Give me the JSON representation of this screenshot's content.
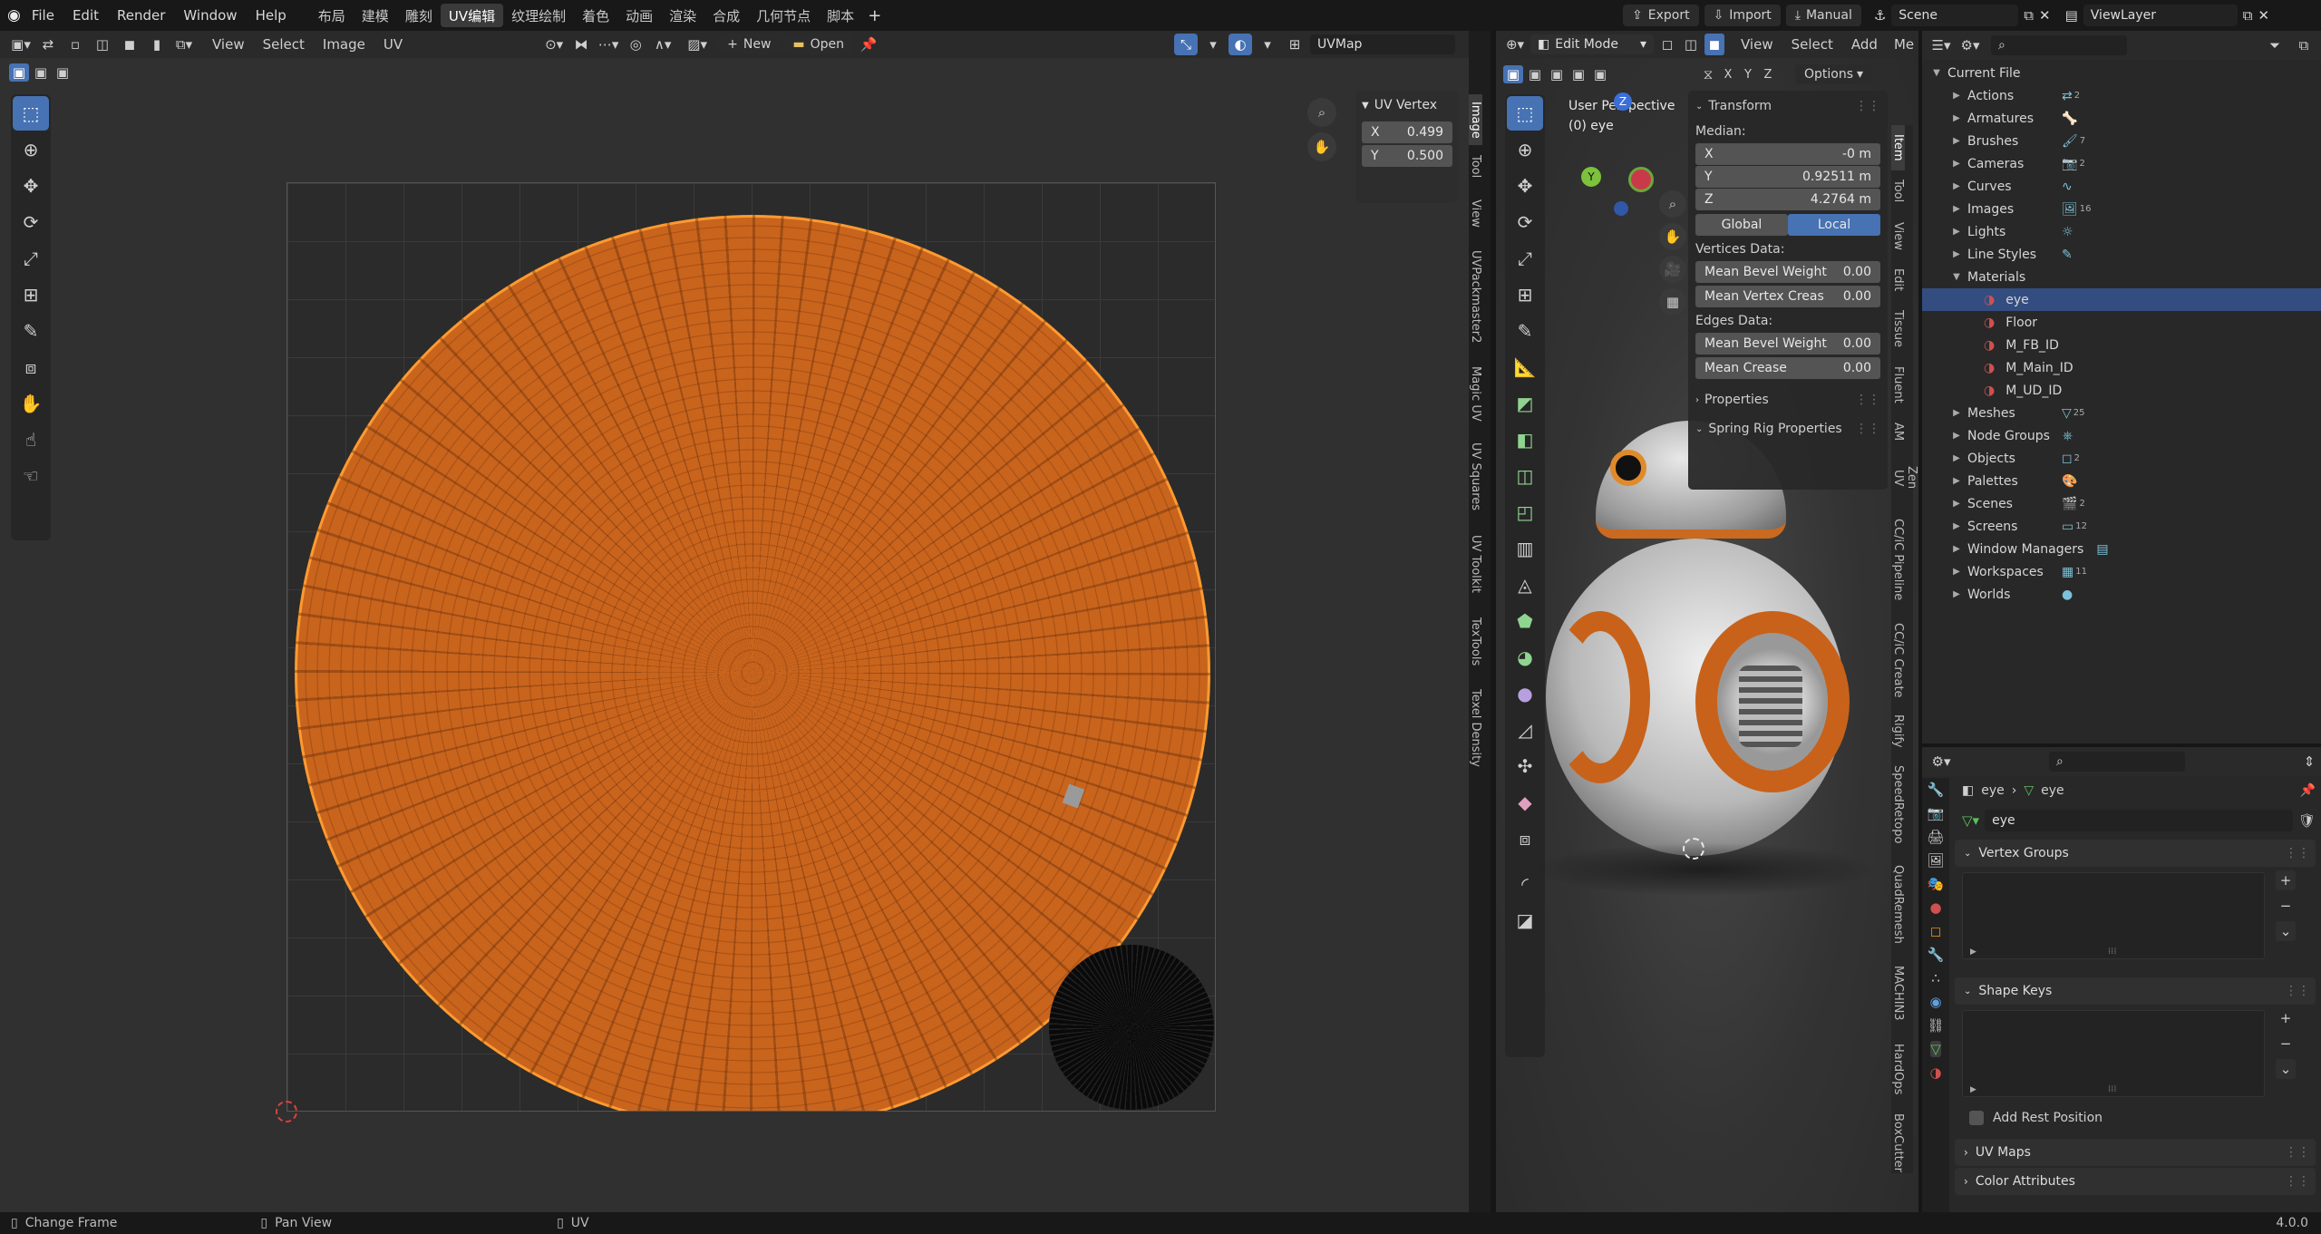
{
  "menu": {
    "file": "File",
    "edit": "Edit",
    "render": "Render",
    "window": "Window",
    "help": "Help"
  },
  "workspaces": [
    "布局",
    "建模",
    "雕刻",
    "UV编辑",
    "纹理绘制",
    "着色",
    "动画",
    "渲染",
    "合成",
    "几何节点",
    "脚本"
  ],
  "active_workspace": "UV编辑",
  "topright": {
    "export": "Export",
    "import": "Import",
    "manual": "Manual",
    "scene": "Scene",
    "viewlayer": "ViewLayer"
  },
  "uv_editor": {
    "view": "View",
    "select": "Select",
    "image": "Image",
    "uv": "UV",
    "new": "New",
    "open": "Open",
    "uvmap": "UVMap",
    "vertex_panel": {
      "title": "UV Vertex",
      "x_label": "X",
      "x_value": "0.499",
      "y_label": "Y",
      "y_value": "0.500"
    },
    "tabs": [
      "Image",
      "Tool",
      "View",
      "UVPackmaster2",
      "Magic UV",
      "UV Squares",
      "UV Toolkit",
      "TexTools",
      "Texel Density"
    ]
  },
  "viewport": {
    "mode": "Edit Mode",
    "view": "View",
    "select": "Select",
    "add": "Add",
    "mesh": "Me",
    "options": "Options",
    "overlay_title": "User Perspective",
    "overlay_object": "(0) eye",
    "axes": {
      "x": "X",
      "y": "Y",
      "z": "Z"
    },
    "transform": {
      "title": "Transform",
      "median": "Median:",
      "x_label": "X",
      "x_value": "-0 m",
      "y_label": "Y",
      "y_value": "0.92511 m",
      "z_label": "Z",
      "z_value": "4.2764 m",
      "global": "Global",
      "local": "Local",
      "vertices_data": "Vertices Data:",
      "mean_bevel_weight": "Mean Bevel Weight",
      "mbw_value": "0.00",
      "mean_vertex_crease": "Mean Vertex Creas",
      "mvc_value": "0.00",
      "edges_data": "Edges Data:",
      "edge_bevel_weight": "Mean Bevel Weight",
      "ebw_value": "0.00",
      "mean_crease": "Mean Crease",
      "mc_value": "0.00"
    },
    "properties": "Properties",
    "spring_rig": "Spring Rig Properties",
    "tabs": [
      "Item",
      "Tool",
      "View",
      "Edit",
      "Tissue",
      "Fluent",
      "AM",
      "Zen UV",
      "CC/iC Pipeline",
      "CC/iC Create",
      "Rigify",
      "SpeedRetopo",
      "QuadRemesh",
      "MACHIN3",
      "HardOps",
      "BoxCutter"
    ]
  },
  "outliner": {
    "root": "Current File",
    "items": [
      {
        "label": "Actions",
        "count": "2"
      },
      {
        "label": "Armatures",
        "count": ""
      },
      {
        "label": "Brushes",
        "count": "7"
      },
      {
        "label": "Cameras",
        "count": "2"
      },
      {
        "label": "Curves",
        "count": ""
      },
      {
        "label": "Images",
        "count": "16"
      },
      {
        "label": "Lights",
        "count": ""
      },
      {
        "label": "Line Styles",
        "count": ""
      },
      {
        "label": "Materials",
        "count": ""
      }
    ],
    "materials": [
      "eye",
      "Floor",
      "M_FB_ID",
      "M_Main_ID",
      "M_UD_ID"
    ],
    "items2": [
      {
        "label": "Meshes",
        "count": "25"
      },
      {
        "label": "Node Groups",
        "count": ""
      },
      {
        "label": "Objects",
        "count": "2"
      },
      {
        "label": "Palettes",
        "count": ""
      },
      {
        "label": "Scenes",
        "count": "2"
      },
      {
        "label": "Screens",
        "count": "12"
      },
      {
        "label": "Window Managers",
        "count": ""
      },
      {
        "label": "Workspaces",
        "count": "11"
      },
      {
        "label": "Worlds",
        "count": ""
      }
    ]
  },
  "props": {
    "breadcrumb_obj": "eye",
    "breadcrumb_data": "eye",
    "mesh_name": "eye",
    "vertex_groups": "Vertex Groups",
    "shape_keys": "Shape Keys",
    "add_rest_position": "Add Rest Position",
    "uv_maps": "UV Maps",
    "color_attributes": "Color Attributes"
  },
  "status": {
    "change_frame": "Change Frame",
    "pan_view": "Pan View",
    "uv": "UV",
    "version": "4.0.0"
  },
  "colors": {
    "accent": "#4772b3",
    "mesh_orange": "#d66a20",
    "vertex_orange": "#ff8c1a",
    "selected_row": "#334d80"
  }
}
